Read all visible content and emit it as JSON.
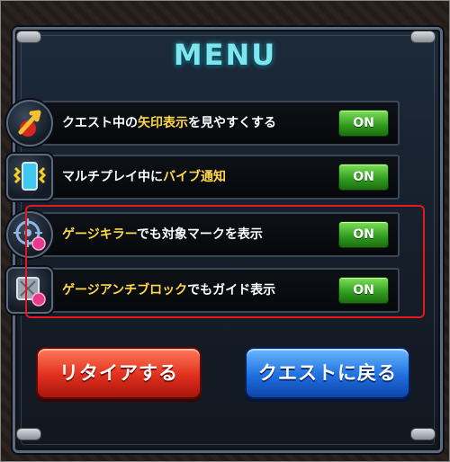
{
  "menu": {
    "title": "MENU"
  },
  "settings": [
    {
      "text_before": "クエスト中の",
      "text_highlight": "矢印表示",
      "text_after": "を見やすくする",
      "toggle": "ON",
      "icon": "arrow-icon"
    },
    {
      "text_before": "マルチプレイ中に",
      "text_highlight": "バイブ通知",
      "text_after": "",
      "toggle": "ON",
      "icon": "phone-vibrate-icon"
    },
    {
      "text_before": "",
      "text_highlight": "ゲージキラー",
      "text_after": "でも対象マークを表示",
      "toggle": "ON",
      "icon": "target-icon"
    },
    {
      "text_before": "",
      "text_highlight": "ゲージアンチブロック",
      "text_after": "でもガイド表示",
      "toggle": "ON",
      "icon": "block-icon"
    }
  ],
  "buttons": {
    "retire": "リタイアする",
    "back": "クエストに戻る"
  },
  "colors": {
    "toggle_on": "#2f9a1e",
    "highlight_text": "#ffd84a",
    "retire_button": "#e0301e",
    "back_button": "#1f6fe0",
    "title": "#7fe6f0",
    "callout_border": "#e8161f"
  }
}
